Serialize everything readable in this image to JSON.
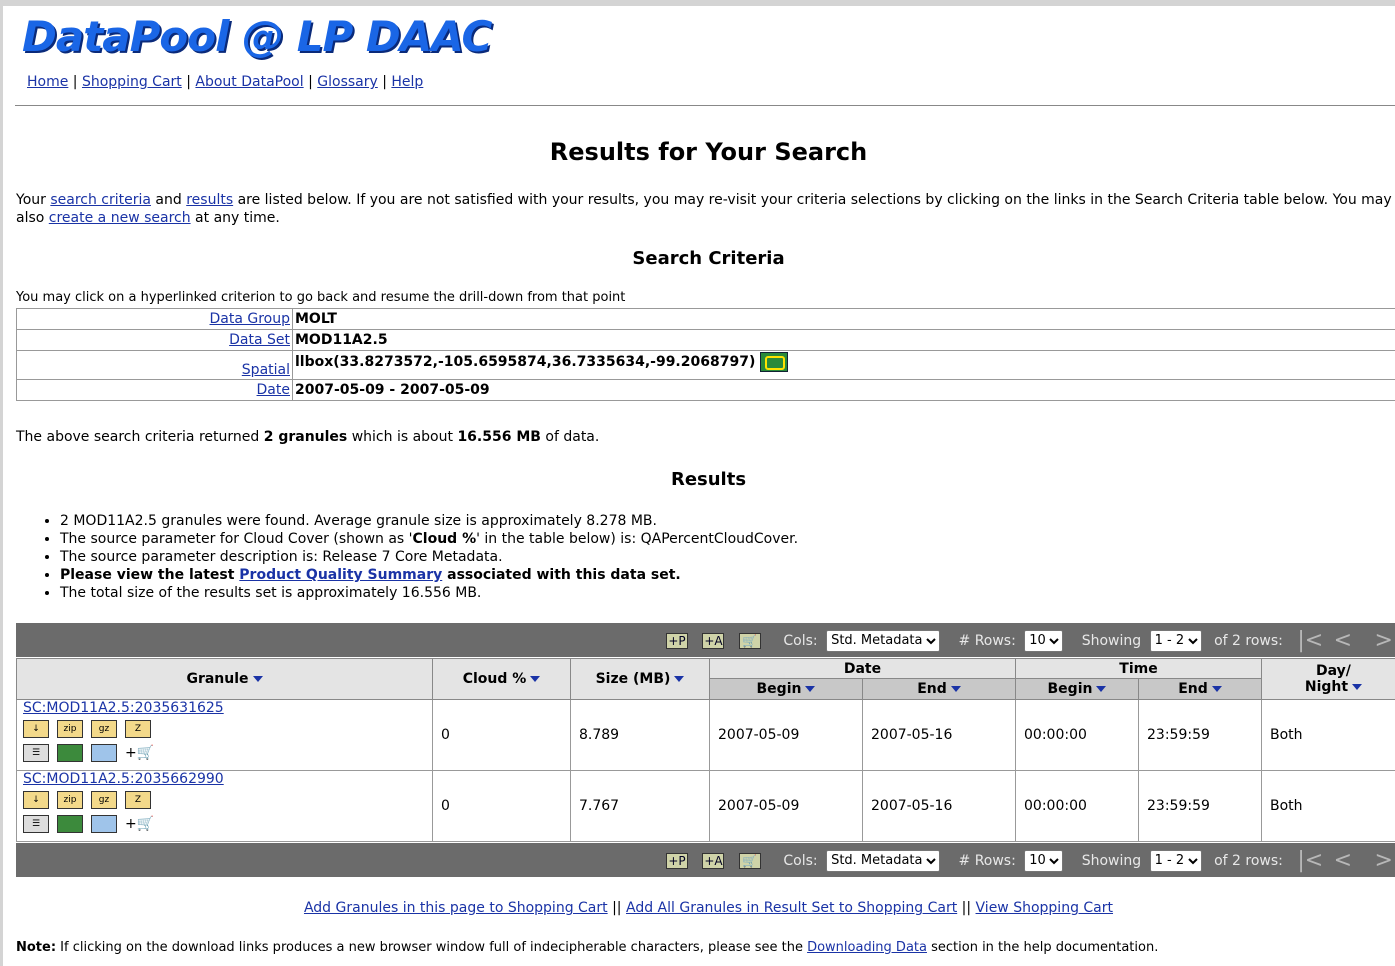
{
  "header": {
    "logo_text": "DataPool @ LP DAAC",
    "nav": [
      "Home",
      "Shopping Cart",
      "About DataPool",
      "Glossary",
      "Help"
    ],
    "nav_sep": "|"
  },
  "page": {
    "title": "Results for Your Search",
    "intro_1": "Your ",
    "intro_link_1": "search criteria",
    "intro_2": " and ",
    "intro_link_2": "results",
    "intro_3": " are listed below. If you are not satisfied with your results, you may re-visit your criteria selections by clicking on the links in the Search Criteria table below. You may also ",
    "intro_link_3": "create a new search",
    "intro_4": " at any time."
  },
  "criteria": {
    "heading": "Search Criteria",
    "note": "You may click on a hyperlinked criterion to go back and resume the drill-down from that point",
    "rows": [
      {
        "label": "Data Group",
        "value": "MOLT"
      },
      {
        "label": "Data Set",
        "value": "MOD11A2.5"
      },
      {
        "label": "Spatial",
        "value": "llbox(33.8273572,-105.6595874,36.7335634,-99.2068797)"
      },
      {
        "label": "Date",
        "value": "2007-05-09 - 2007-05-09"
      }
    ]
  },
  "summary": {
    "pre": "The above search criteria returned ",
    "granules": "2 granules",
    "mid": " which is about ",
    "size": "16.556 MB",
    "post": " of data."
  },
  "results": {
    "heading": "Results",
    "b1": "2 MOD11A2.5 granules were found. Average granule size is approximately 8.278 MB.",
    "b2_pre": "The source parameter for Cloud Cover (shown as '",
    "b2_bold": "Cloud %",
    "b2_post": "' in the table below) is: QAPercentCloudCover.",
    "b3": "The source parameter description is: Release 7 Core Metadata.",
    "b4_pre": "Please view the latest ",
    "b4_link": "Product Quality Summary",
    "b4_post": " associated with this data set.",
    "b5": "The total size of the results set is approximately 16.556 MB."
  },
  "toolbar": {
    "cols_label": "Cols:",
    "cols_value": "Std. Metadata",
    "rows_label": "# Rows:",
    "rows_value": "10",
    "showing_label": "Showing",
    "showing_value": "1 - 2",
    "of_rows": "of 2 rows:",
    "first": "|<",
    "prev": "<",
    "next": ">",
    "last": ">|"
  },
  "table": {
    "headers": {
      "granule": "Granule",
      "cloud": "Cloud %",
      "size": "Size (MB)",
      "date": "Date",
      "time": "Time",
      "begin": "Begin",
      "end": "End",
      "daynight_1": "Day/",
      "daynight_2": "Night"
    },
    "icons": {
      "zip": "zip",
      "gz": "gz",
      "z": "Z"
    },
    "rows": [
      {
        "granule": "SC:MOD11A2.5:2035631625",
        "cloud": "0",
        "size": "8.789",
        "date_begin": "2007-05-09",
        "date_end": "2007-05-16",
        "time_begin": "00:00:00",
        "time_end": "23:59:59",
        "day_night": "Both"
      },
      {
        "granule": "SC:MOD11A2.5:2035662990",
        "cloud": "0",
        "size": "7.767",
        "date_begin": "2007-05-09",
        "date_end": "2007-05-16",
        "time_begin": "00:00:00",
        "time_end": "23:59:59",
        "day_night": "Both"
      }
    ]
  },
  "bottom": {
    "link1": "Add Granules in this page to Shopping Cart",
    "link2": "Add All Granules in Result Set to Shopping Cart",
    "link3": "View Shopping Cart",
    "sep": "||",
    "note_bold": "Note:",
    "note_pre": " If clicking on the download links produces a new browser window full of indecipherable characters, please see the ",
    "note_link": "Downloading Data",
    "note_post": " section in the help documentation."
  }
}
